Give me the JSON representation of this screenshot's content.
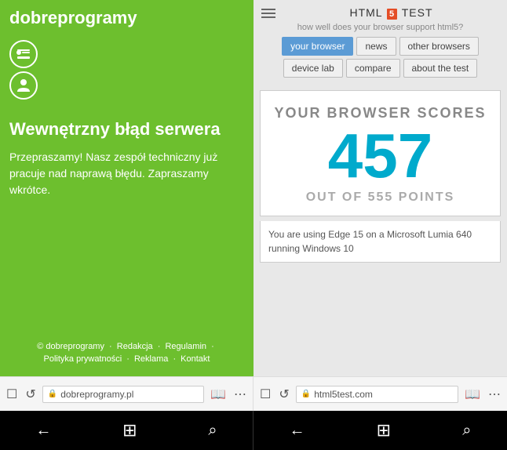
{
  "left": {
    "logo_plain": "dobre",
    "logo_bold": "programy",
    "error_title": "Wewnętrzny błąd serwera",
    "error_description": "Przepraszamy! Nasz zespół techniczny już pracuje nad naprawą błędu. Zapraszamy wkrótce.",
    "footer_line1_copy": "© dobreprogramy",
    "footer_line1_sep1": "·",
    "footer_line1_redakcja": "Redakcja",
    "footer_line1_sep2": "·",
    "footer_line1_regulamin": "Regulamin",
    "footer_line1_sep3": "·",
    "footer_line2_polityka": "Polityka prywatności",
    "footer_line2_sep1": "·",
    "footer_line2_reklama": "Reklama",
    "footer_line2_sep2": "·",
    "footer_line2_kontakt": "Kontakt"
  },
  "right": {
    "hamburger_label": "menu",
    "site_title_pre": "HTML",
    "site_title_badge": "5",
    "site_title_post": "TEST",
    "site_subtitle": "how well does your browser support html5?",
    "nav_buttons": [
      {
        "label": "your browser",
        "active": true
      },
      {
        "label": "news",
        "active": false
      },
      {
        "label": "other browsers",
        "active": false
      },
      {
        "label": "device lab",
        "active": false
      },
      {
        "label": "compare",
        "active": false
      },
      {
        "label": "about the test",
        "active": false
      }
    ],
    "score_label": "YOUR BROWSER SCORES",
    "score_number": "457",
    "score_out_of": "OUT OF 555 POINTS",
    "score_info": "You are using Edge 15 on a Microsoft Lumia 640 running Windows 10"
  },
  "browser_bars": [
    {
      "icons": [
        "⧉",
        "↺",
        "🔒"
      ],
      "url": "dobreprogramy.pl",
      "extra_icons": [
        "📖",
        "···"
      ]
    },
    {
      "icons": [
        "⧉",
        "↺",
        "🔒"
      ],
      "url": "html5test.com",
      "extra_icons": [
        "📖",
        "···"
      ]
    }
  ],
  "nav_bars": [
    {
      "back": "←",
      "home": "⊞",
      "search": "⌕"
    },
    {
      "back": "←",
      "home": "⊞",
      "search": "⌕"
    }
  ]
}
